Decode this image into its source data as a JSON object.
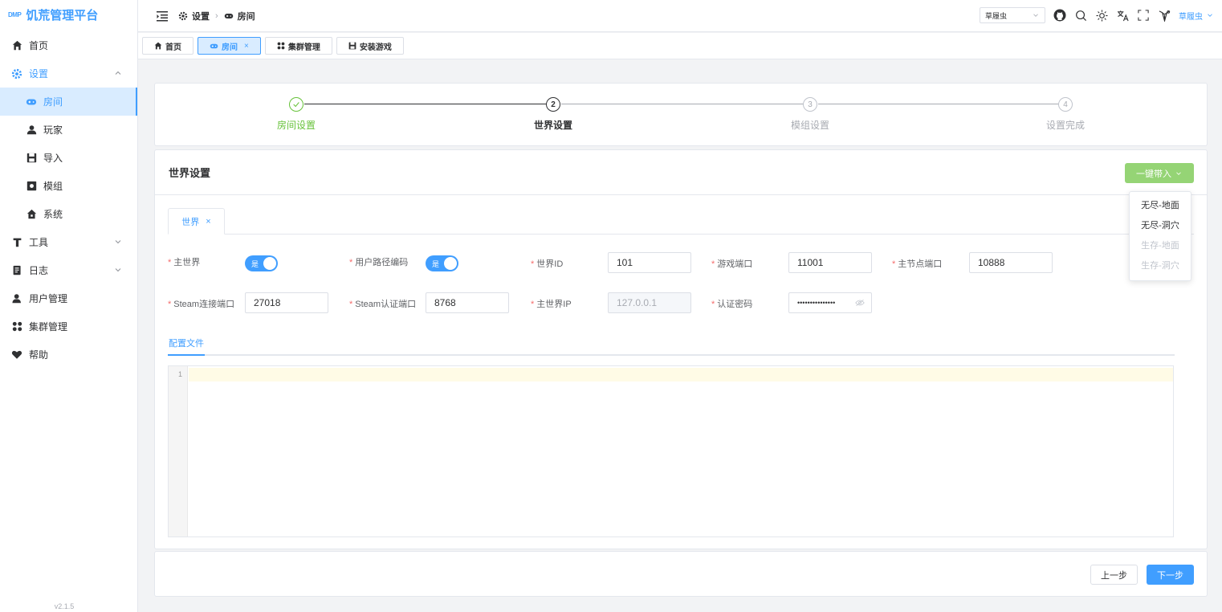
{
  "app": {
    "logo_mark": "DMP",
    "title": "饥荒管理平台",
    "version": "v2.1.5"
  },
  "sidebar": {
    "items": [
      {
        "label": "首页"
      },
      {
        "label": "设置"
      },
      {
        "label": "房间"
      },
      {
        "label": "玩家"
      },
      {
        "label": "导入"
      },
      {
        "label": "模组"
      },
      {
        "label": "系统"
      },
      {
        "label": "工具"
      },
      {
        "label": "日志"
      },
      {
        "label": "用户管理"
      },
      {
        "label": "集群管理"
      },
      {
        "label": "帮助"
      }
    ]
  },
  "header": {
    "breadcrumb": [
      "设置",
      "房间"
    ],
    "cluster_select": "草履虫",
    "user": "草履虫"
  },
  "tags": [
    {
      "label": "首页"
    },
    {
      "label": "房间",
      "close": "×"
    },
    {
      "label": "集群管理"
    },
    {
      "label": "安装游戏"
    }
  ],
  "steps": [
    {
      "num": "1",
      "label": "房间设置",
      "status": "done"
    },
    {
      "num": "2",
      "label": "世界设置",
      "status": "current"
    },
    {
      "num": "3",
      "label": "模组设置",
      "status": "wait"
    },
    {
      "num": "4",
      "label": "设置完成",
      "status": "wait"
    }
  ],
  "world": {
    "title": "世界设置",
    "import_button": "一键带入",
    "import_options": [
      {
        "label": "无尽-地面",
        "disabled": false
      },
      {
        "label": "无尽-洞穴",
        "disabled": false
      },
      {
        "label": "生存-地面",
        "disabled": true
      },
      {
        "label": "生存-洞穴",
        "disabled": true
      }
    ],
    "tab": {
      "label": "世界",
      "close": "×"
    },
    "fields": {
      "main_world": {
        "label": "主世界",
        "switch_text": "是"
      },
      "path_encoding": {
        "label": "用户路径编码",
        "switch_text": "是"
      },
      "world_id": {
        "label": "世界ID",
        "value": "101"
      },
      "game_port": {
        "label": "游戏端口",
        "value": "11001"
      },
      "master_port": {
        "label": "主节点端口",
        "value": "10888"
      },
      "steam_conn_port": {
        "label": "Steam连接端口",
        "value": "27018"
      },
      "steam_auth_port": {
        "label": "Steam认证端口",
        "value": "8768"
      },
      "master_ip": {
        "label": "主世界IP",
        "value": "127.0.0.1"
      },
      "auth_password": {
        "label": "认证密码",
        "value": "•••••••••••••••"
      }
    },
    "config_tab": "配置文件",
    "editor_line": "1"
  },
  "footer": {
    "prev": "上一步",
    "next": "下一步"
  },
  "colors": {
    "primary": "#409eff",
    "success": "#67c23a",
    "success_light": "#95d475",
    "danger": "#f56c6c"
  }
}
